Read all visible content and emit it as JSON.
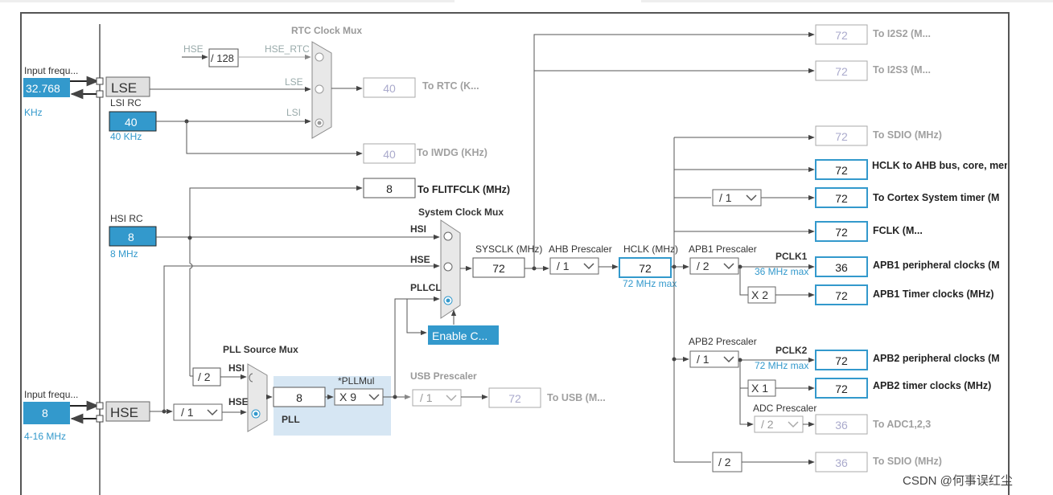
{
  "inputs": {
    "lse": {
      "title": "Input frequ...",
      "value": "32.768",
      "unit": "KHz",
      "name": "LSE"
    },
    "lsi": {
      "title": "LSI RC",
      "value": "40",
      "unit": "40 KHz"
    },
    "hsi": {
      "title": "HSI RC",
      "value": "8",
      "unit": "8 MHz"
    },
    "hse": {
      "title": "Input frequ...",
      "value": "8",
      "unit": "4-16 MHz",
      "name": "HSE"
    }
  },
  "rtc_mux": {
    "title": "RTC Clock Mux",
    "hse_label": "HSE",
    "div_128": "/ 128",
    "hse_rtc": "HSE_RTC",
    "lse": "LSE",
    "lsi": "LSI"
  },
  "outputs": {
    "rtc": {
      "value": "40",
      "label": "To RTC (K..."
    },
    "iwdg": {
      "value": "40",
      "label": "To IWDG (KHz)"
    },
    "flitf": {
      "value": "8",
      "label": "To FLITFCLK (MHz)"
    },
    "i2s2": {
      "value": "72",
      "label": "To I2S2 (M..."
    },
    "i2s3": {
      "value": "72",
      "label": "To I2S3 (M..."
    },
    "sdio1": {
      "value": "72",
      "label": "To SDIO (MHz)"
    },
    "hclk_ahb": {
      "value": "72",
      "label": "HCLK to AHB bus, core, memory and DMA (MHz)"
    },
    "cortex": {
      "value": "72",
      "label": "To Cortex System timer (M"
    },
    "fclk": {
      "value": "72",
      "label": "FCLK (M..."
    },
    "apb1_periph": {
      "value": "36",
      "label": "APB1 peripheral clocks (M"
    },
    "apb1_timer": {
      "value": "72",
      "label": "APB1 Timer clocks (MHz)"
    },
    "apb2_periph": {
      "value": "72",
      "label": "APB2 peripheral clocks (M"
    },
    "apb2_timer": {
      "value": "72",
      "label": "APB2 timer clocks (MHz)"
    },
    "adc": {
      "value": "36",
      "label": "To ADC1,2,3"
    },
    "sdio2": {
      "value": "36",
      "label": "To SDIO (MHz)"
    },
    "usb": {
      "value": "72",
      "label": "To USB (M..."
    }
  },
  "sysclk_mux": {
    "title": "System Clock Mux",
    "hsi": "HSI",
    "hse": "HSE",
    "pllclk": "PLLCLK",
    "enable_btn": "Enable C..."
  },
  "sysclk": {
    "label": "SYSCLK (MHz)",
    "value": "72"
  },
  "ahb": {
    "label": "AHB Prescaler",
    "value": "/ 1"
  },
  "hclk": {
    "label": "HCLK (MHz)",
    "value": "72",
    "max": "72 MHz max"
  },
  "apb1": {
    "label": "APB1 Prescaler",
    "value": "/ 2",
    "pclk": "PCLK1",
    "max": "36 MHz max",
    "timer_mult": "X 2"
  },
  "apb2": {
    "label": "APB2 Prescaler",
    "value": "/ 1",
    "pclk": "PCLK2",
    "max": "72 MHz max",
    "timer_mult": "X 1"
  },
  "cortex_div": "/ 1",
  "adc_prescaler": {
    "label": "ADC Prescaler",
    "value": "/ 2"
  },
  "sdio_div": "/ 2",
  "pll_source_mux": {
    "title": "PLL Source Mux",
    "hsi_div": "/ 2",
    "hsi": "HSI",
    "hse": "HSE",
    "hse_div": "/ 1"
  },
  "pll": {
    "label": "PLL",
    "value": "8",
    "mul_label": "*PLLMul",
    "mul_value": "X 9"
  },
  "usb_prescaler": {
    "label": "USB Prescaler",
    "value": "/ 1"
  },
  "watermark": "CSDN @何事误红尘",
  "colors": {
    "accent": "#3399cc",
    "box_border": "#3399cc",
    "line": "#555555",
    "pll_bg": "#d6e6f3"
  }
}
